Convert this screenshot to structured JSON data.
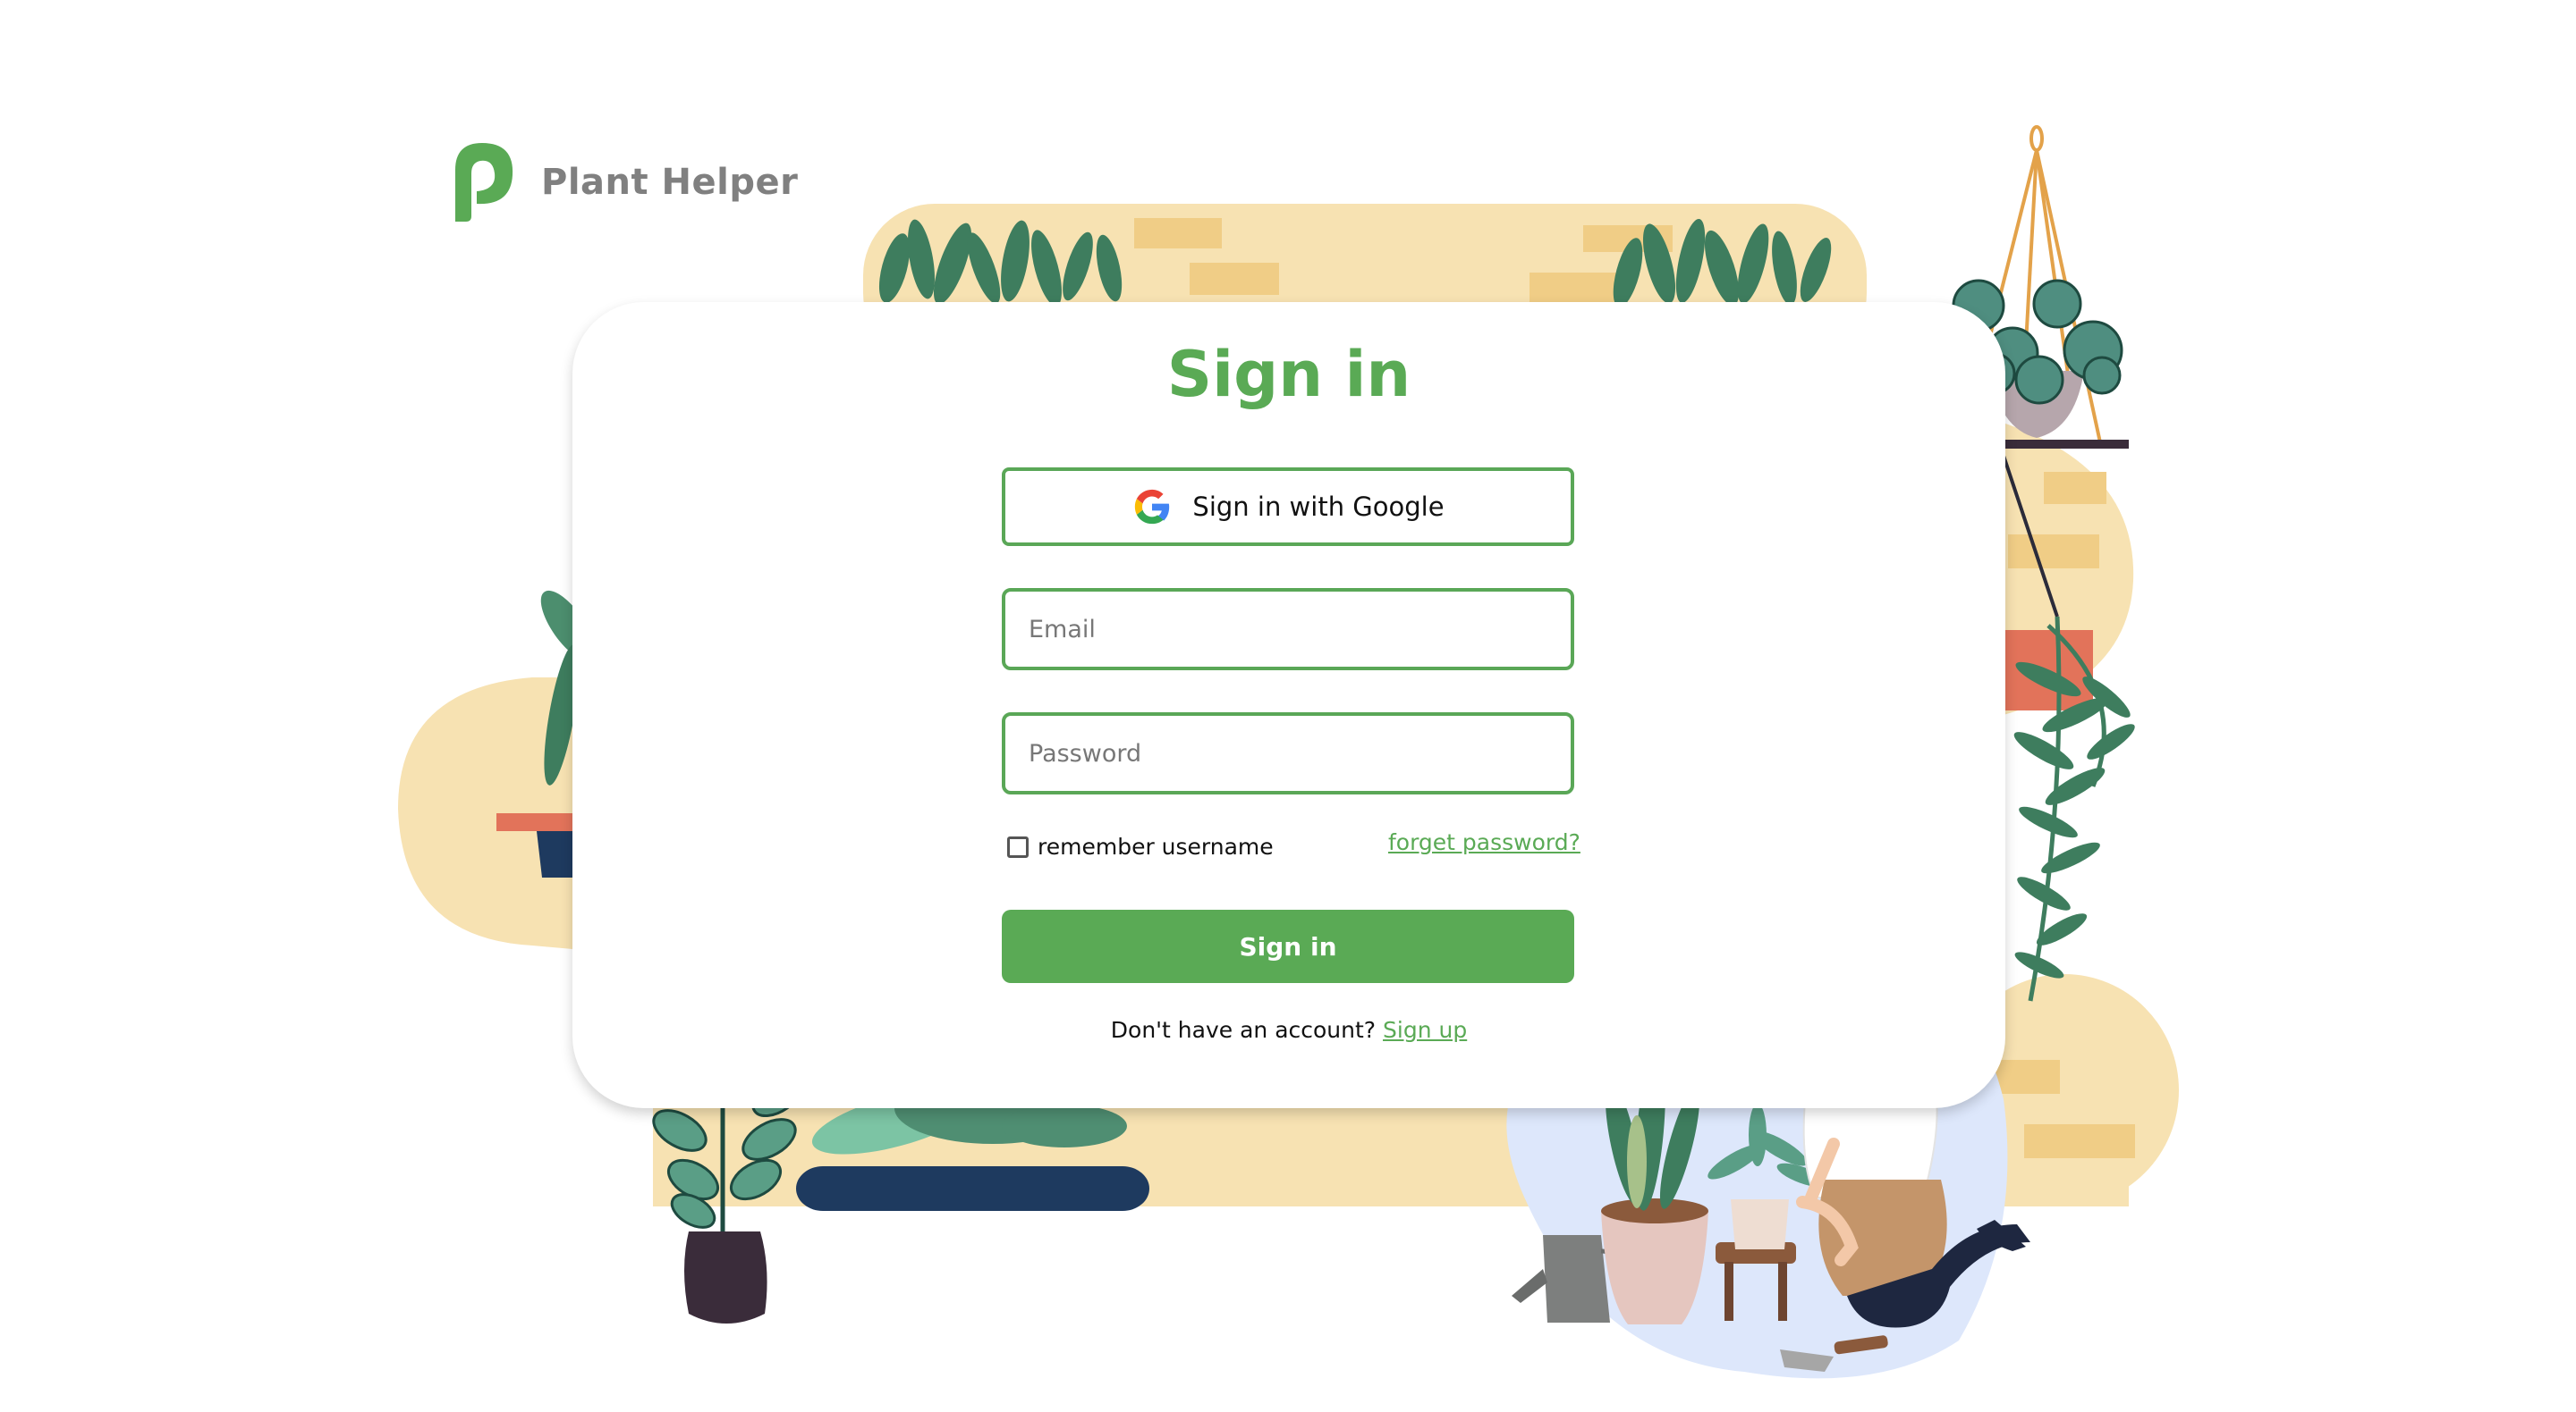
{
  "brand": {
    "name": "Plant Helper",
    "logo_icon": "leaf-p-logo-icon",
    "accent": "#5aaa55"
  },
  "signin": {
    "title": "Sign in",
    "google_button_label": "Sign in with Google",
    "google_icon": "google-g-icon",
    "email_placeholder": "Email",
    "email_value": "",
    "password_placeholder": "Password",
    "password_value": "",
    "remember_label": "remember username",
    "remember_checked": false,
    "forgot_label": "forget password?",
    "submit_label": "Sign in",
    "no_account_text": "Don't have an account?",
    "signup_label": "Sign up"
  },
  "colors": {
    "primary_green": "#5aaa55",
    "border_green": "#5aa757",
    "wall_beige": "#f7e2b2",
    "brick_yellow": "#f0cd86",
    "leaf_dark": "#3e7d5e",
    "leaf_light": "#5a9e86",
    "pot_navy": "#1e3a5f",
    "blob_blue": "#dde7fb"
  }
}
